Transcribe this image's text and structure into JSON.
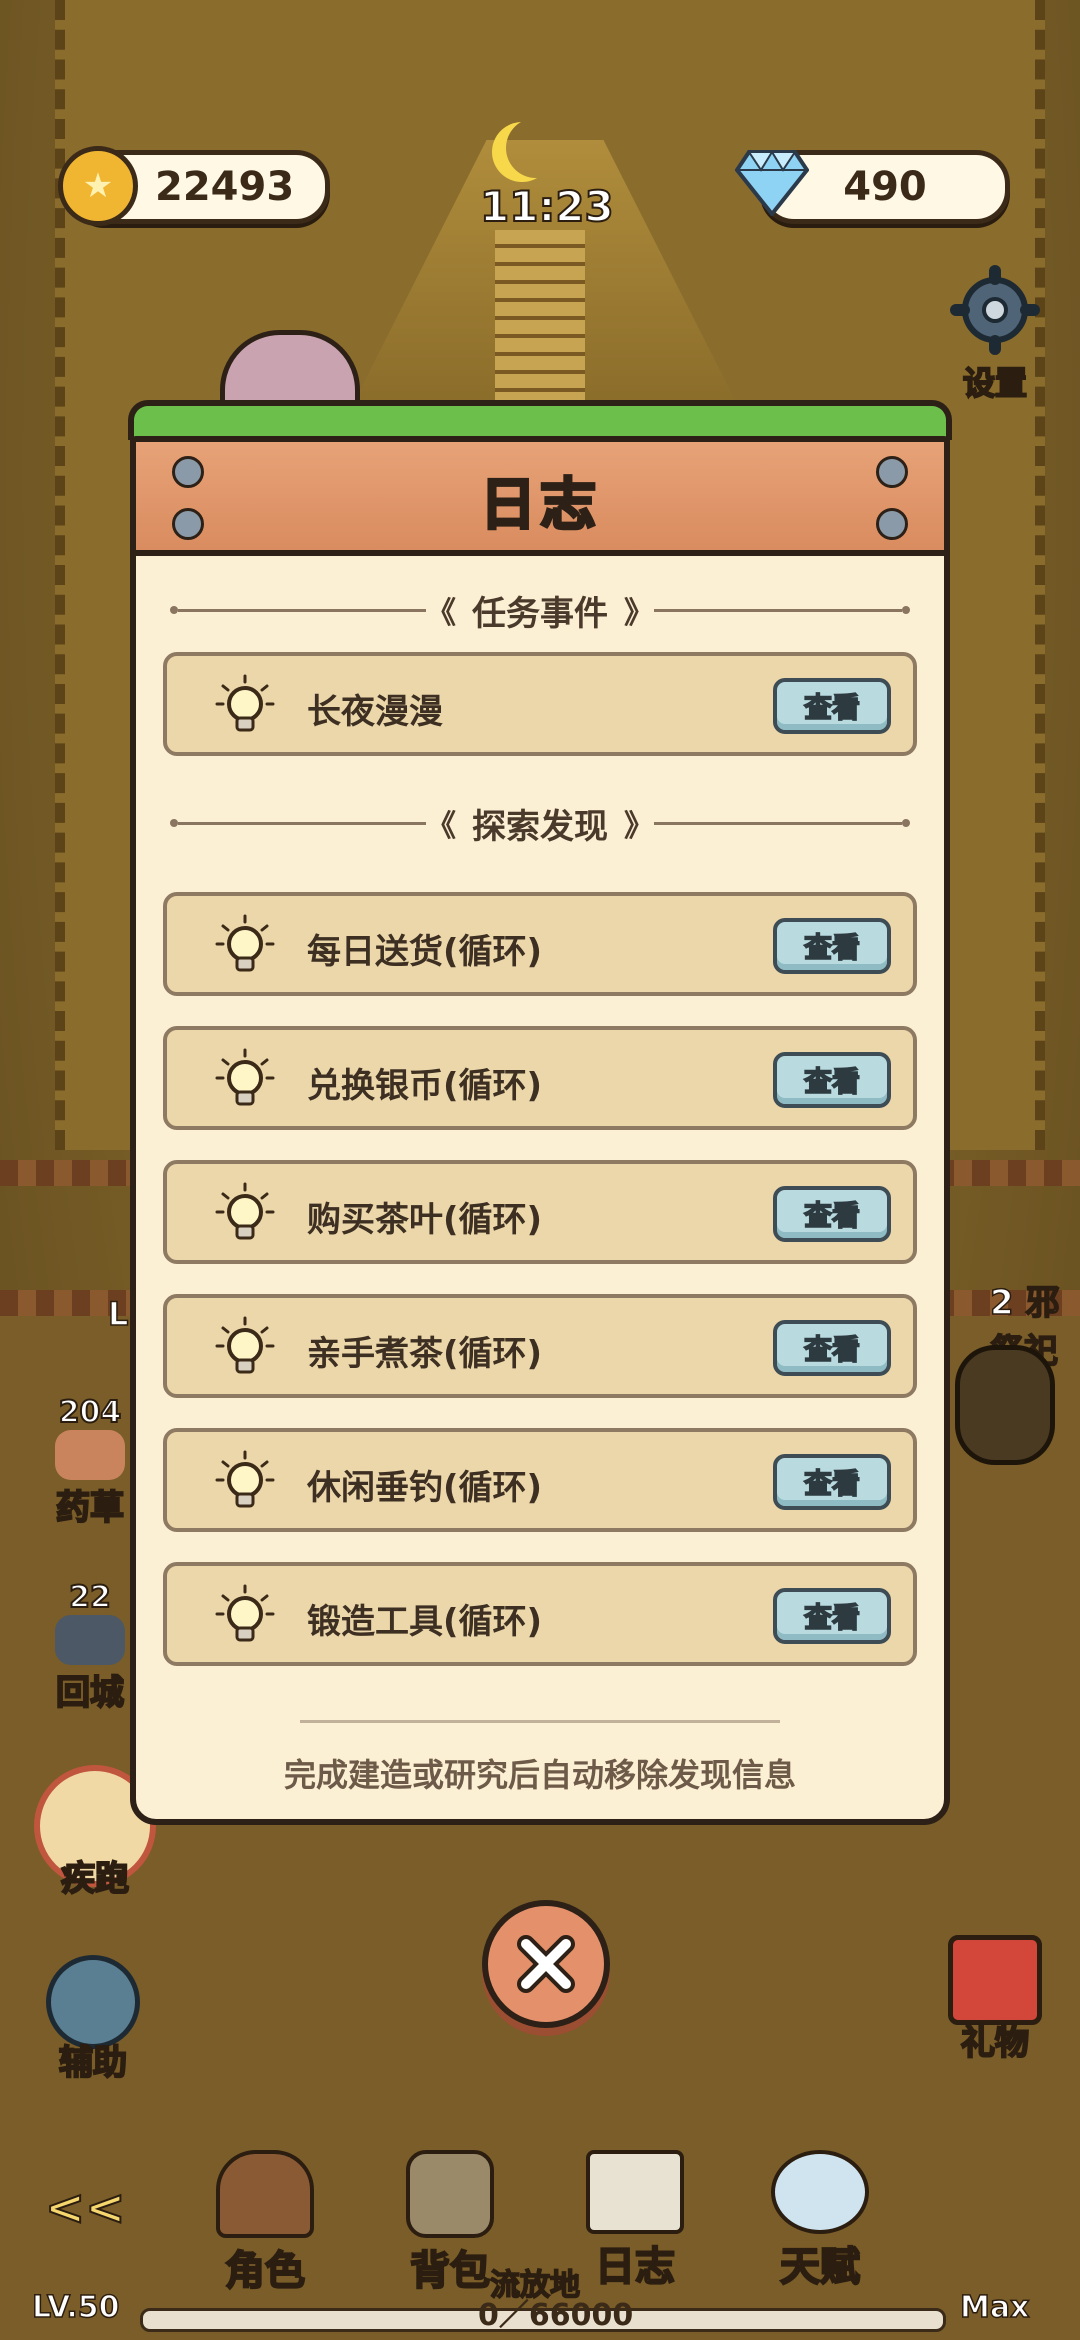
{
  "hud": {
    "coins": "22493",
    "gems": "490",
    "time": "11:23",
    "settings_label": "设置"
  },
  "side_left": {
    "herb_count": "204",
    "herb_label": "药草",
    "return_count": "22",
    "return_label": "回城",
    "sprint_label": "疾跑",
    "assist_label": "辅助",
    "partial_letter": "L"
  },
  "side_right": {
    "enemy_label": "2 邪祭祀",
    "gift_label": "礼物"
  },
  "modal": {
    "title": "日志",
    "section_tasks": "任务事件",
    "section_explore": "探索发现",
    "chevron_left": "《",
    "chevron_right": "》",
    "tasks": [
      {
        "name": "长夜漫漫",
        "action": "查看"
      }
    ],
    "discoveries": [
      {
        "name": "每日送货(循环)",
        "action": "查看"
      },
      {
        "name": "兑换银币(循环)",
        "action": "查看"
      },
      {
        "name": "购买茶叶(循环)",
        "action": "查看"
      },
      {
        "name": "亲手煮茶(循环)",
        "action": "查看"
      },
      {
        "name": "休闲垂钓(循环)",
        "action": "查看"
      },
      {
        "name": "锻造工具(循环)",
        "action": "查看"
      }
    ],
    "footer": "完成建造或研究后自动移除发现信息"
  },
  "bottom_nav": {
    "back_glyph": "<<",
    "items": [
      {
        "label": "角色"
      },
      {
        "label": "背包"
      },
      {
        "label": "日志"
      },
      {
        "label": "天赋"
      }
    ],
    "center_label": "流放地",
    "xp": "0／66000",
    "level": "LV.50",
    "max": "Max"
  },
  "colors": {
    "panel": "#fcf0d4",
    "plank": "#d98c5f",
    "row": "#ecd7aa",
    "view_button": "#b9dbe0",
    "close_button": "#e4906a"
  }
}
